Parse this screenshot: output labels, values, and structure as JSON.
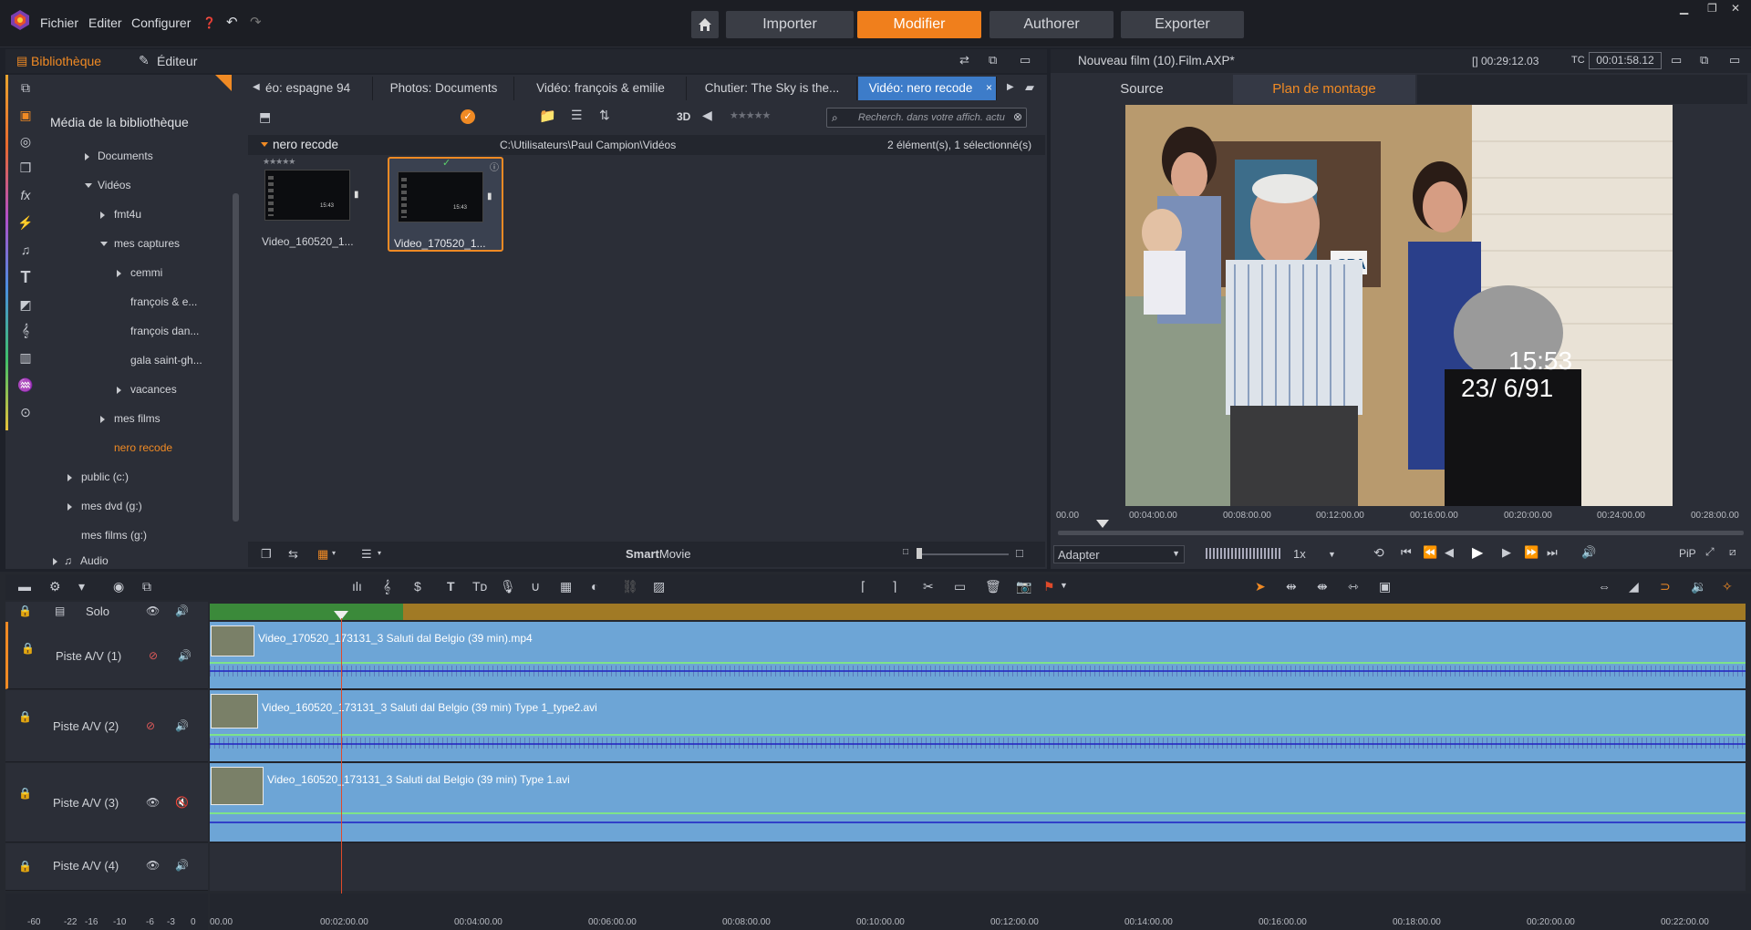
{
  "menu": {
    "items": [
      "Fichier",
      "Editer",
      "Configurer"
    ]
  },
  "nav": {
    "importer": "Importer",
    "modifier": "Modifier",
    "authorer": "Authorer",
    "exporter": "Exporter"
  },
  "library": {
    "tab_library": "Bibliothèque",
    "tab_editor": "Éditeur",
    "heading": "Média de la bibliothèque",
    "tree": [
      {
        "label": "Documents"
      },
      {
        "label": "Vidéos"
      },
      {
        "label": "fmt4u"
      },
      {
        "label": "mes captures"
      },
      {
        "label": "cemmi"
      },
      {
        "label": "françois & e..."
      },
      {
        "label": "françois dan..."
      },
      {
        "label": "gala saint-gh..."
      },
      {
        "label": "vacances"
      },
      {
        "label": "mes films"
      },
      {
        "label": "nero recode"
      },
      {
        "label": "public (c:)"
      },
      {
        "label": "mes dvd (g:)"
      },
      {
        "label": "mes films (g:)"
      },
      {
        "label": "Audio"
      }
    ],
    "tabs": [
      "éo: espagne 94",
      "Photos: Documents",
      "Vidéo: françois & emilie",
      "Chutier: The Sky is the...",
      "Vidéo: nero recode"
    ],
    "toolbar_3d": "3D",
    "search_placeholder": "Recherch. dans votre affich. actu",
    "folder_name": "nero recode",
    "path": "C:\\Utilisateurs\\Paul Campion\\Vidéos",
    "count": "2 élément(s), 1 sélectionné(s)",
    "files": [
      {
        "name": "Video_160520_1...",
        "selected": false
      },
      {
        "name": "Video_170520_1...",
        "selected": true
      }
    ],
    "smartmovie_bold": "Smart",
    "smartmovie_rest": "Movie"
  },
  "player": {
    "title": "Nouveau film (10).Film.AXP*",
    "duration": "[] 00:29:12.03",
    "tc_label": "TC",
    "tc_value": "00:01:58.12",
    "tab_source": "Source",
    "tab_timeline": "Plan de montage",
    "overlay_time": "15:53",
    "overlay_date": "23/ 6/91",
    "sign_text": "SPA",
    "ruler": [
      "00.00",
      "00:04:00.00",
      "00:08:00.00",
      "00:12:00.00",
      "00:16:00.00",
      "00:20:00.00",
      "00:24:00.00",
      "00:28:00.00"
    ],
    "fit_label": "Adapter",
    "speed": "1x",
    "pip": "PiP"
  },
  "timeline": {
    "solo": "Solo",
    "tracks": [
      {
        "name": "Piste A/V (1)",
        "clip": "Video_170520_173131_3 Saluti dal Belgio (39 min).mp4"
      },
      {
        "name": "Piste A/V (2)",
        "clip": "Video_160520_173131_3 Saluti dal Belgio (39 min) Type 1_type2.avi"
      },
      {
        "name": "Piste A/V (3)",
        "clip": "Video_160520_173131_3 Saluti dal Belgio (39 min) Type 1.avi"
      },
      {
        "name": "Piste A/V (4)",
        "clip": ""
      }
    ],
    "meter": [
      "-60",
      "-22",
      "-16",
      "-10",
      "-6",
      "-3",
      "0"
    ],
    "ruler": [
      "00.00",
      "00:02:00.00",
      "00:04:00.00",
      "00:06:00.00",
      "00:08:00.00",
      "00:10:00.00",
      "00:12:00.00",
      "00:14:00.00",
      "00:16:00.00",
      "00:18:00.00",
      "00:20:00.00",
      "00:22:00.00"
    ]
  },
  "colors": {
    "accent": "#f07f1c",
    "tab_active": "#3d7cc9",
    "clip": "#6da5d6",
    "playhead": "#e04a2a"
  }
}
